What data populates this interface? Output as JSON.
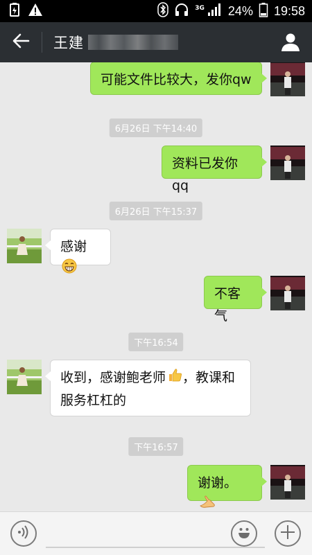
{
  "status_bar": {
    "network": "3G",
    "battery": "24%",
    "time": "19:58"
  },
  "header": {
    "title": "王建"
  },
  "messages": [
    {
      "side": "me",
      "text": "可能文件比较大，发你qw"
    },
    {
      "type": "time",
      "text": "6月26日 下午14:40"
    },
    {
      "side": "me",
      "text": "资料已发你qq"
    },
    {
      "type": "time",
      "text": "6月26日 下午15:37"
    },
    {
      "side": "other",
      "text": "感谢"
    },
    {
      "side": "me",
      "text": "不客气"
    },
    {
      "type": "time",
      "text": "下午16:54"
    },
    {
      "side": "other",
      "text_line1": "收到，感谢鲍老师",
      "text_line1b": "，教课和",
      "text_line2": "服务杠杠的"
    },
    {
      "type": "time",
      "text": "下午16:57"
    },
    {
      "side": "me",
      "text": "谢谢。"
    }
  ],
  "icons": {
    "back": "back-arrow-icon",
    "profile": "person-icon",
    "voice": "voice-icon",
    "emoji": "emoji-icon",
    "more": "plus-icon"
  },
  "colors": {
    "bubble_me": "#a0e75a",
    "bubble_other": "#ffffff",
    "header_bg": "#2b2f33",
    "chat_bg": "#e9e9e9"
  }
}
